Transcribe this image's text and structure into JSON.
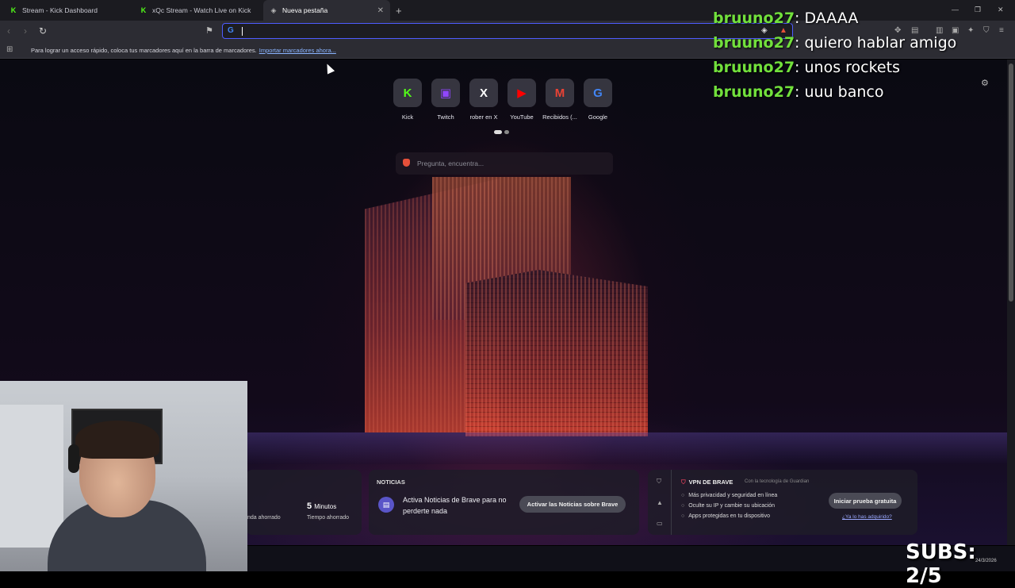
{
  "tabs": [
    {
      "label": "Stream - Kick Dashboard",
      "icon": "kick-icon"
    },
    {
      "label": "xQc Stream - Watch Live on Kick",
      "icon": "kick-icon"
    },
    {
      "label": "Nueva pestaña",
      "icon": "brave-icon"
    }
  ],
  "bookmark_bar": {
    "message": "Para lograr un acceso rápido, coloca tus marcadores aquí en la barra de marcadores.",
    "link": "Importar marcadores ahora..."
  },
  "shortcuts": [
    {
      "label": "Kick",
      "icon": "kick-icon",
      "color": "#53fc18",
      "glyph": "K"
    },
    {
      "label": "Twitch",
      "icon": "twitch-icon",
      "color": "#9146ff",
      "glyph": "▣"
    },
    {
      "label": "rober en X",
      "icon": "x-icon",
      "color": "#ffffff",
      "glyph": "X"
    },
    {
      "label": "YouTube",
      "icon": "youtube-icon",
      "color": "#ff0000",
      "glyph": "▶"
    },
    {
      "label": "Recibidos (...",
      "icon": "gmail-icon",
      "color": "#ea4335",
      "glyph": "M"
    },
    {
      "label": "Google",
      "icon": "google-icon",
      "color": "#4285f4",
      "glyph": "G"
    }
  ],
  "search": {
    "placeholder": "Pregunta, encuentra..."
  },
  "stats": {
    "value": "5",
    "unit": "Minutos",
    "caption_left": "nda ahorrado",
    "caption_right": "Tiempo ahorrado"
  },
  "news": {
    "header": "NOTICIAS",
    "text": "Activa Noticias de Brave para no perderte nada",
    "button": "Activar las Noticias sobre Brave"
  },
  "vpn": {
    "title": "VPN DE BRAVE",
    "tech": "Con la tecnología de Guardian",
    "features": [
      "Más privacidad y seguridad en línea",
      "Oculte su IP y cambie su ubicación",
      "Apps protegidas en tu dispositivo"
    ],
    "button": "Iniciar prueba gratuita",
    "link": "¿Ya lo has adquirido?"
  },
  "chat": [
    {
      "user": "bruuno27",
      "message": ": DAAAA"
    },
    {
      "user": "bruuno27",
      "message": ": quiero hablar amigo"
    },
    {
      "user": "bruuno27",
      "message": ": unos rockets"
    },
    {
      "user": "bruuno27",
      "message": ": uuu banco"
    }
  ],
  "subs": "SUBS: 2/5",
  "clock": "24/3/2026"
}
